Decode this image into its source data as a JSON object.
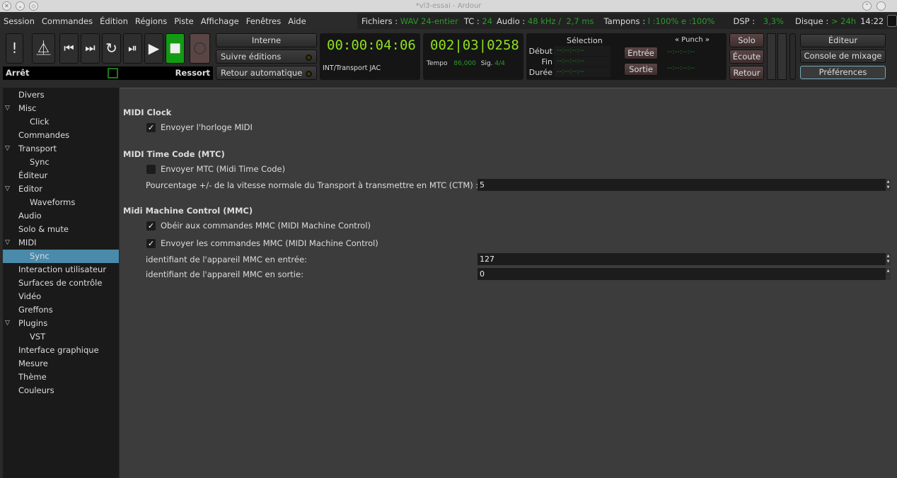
{
  "window": {
    "title": "*vl3-essai - Ardour"
  },
  "menu": [
    "Session",
    "Commandes",
    "Édition",
    "Régions",
    "Piste",
    "Affichage",
    "Fenêtres",
    "Aide"
  ],
  "status": {
    "files_label": "Fichiers : ",
    "files_value": "WAV 24-entier",
    "tc_label": "TC : ",
    "tc_value": "24",
    "audio_label": "Audio : ",
    "audio_value": "48 kHz /  2,7 ms",
    "buffers_label": "Tampons : ",
    "buffers_value": "l :100% e :100%",
    "dsp_label": "DSP : ",
    "dsp_value": "3,3%",
    "disk_label": "Disque : ",
    "disk_value": "> 24h",
    "time": "14:22"
  },
  "transport": {
    "state": "Arrêt",
    "spring": "Ressort",
    "sync_label": "Interne",
    "follow_edits": "Suivre éditions",
    "auto_return": "Retour automatique"
  },
  "clock1": {
    "value": "00:00:04:06",
    "source": "INT/Transport JAC"
  },
  "clock2": {
    "value": "002|03|0258",
    "tempo_label": "Tempo",
    "tempo_value": "86,000",
    "sig_label": "Sig.",
    "sig_value": "4/4"
  },
  "selection": {
    "title": "Sélection",
    "start": "Début",
    "end": "Fin",
    "length": "Durée",
    "empty": "--:--:--:--",
    "punch": "« Punch »",
    "in": "Entrée",
    "out": "Sortie"
  },
  "monitor": {
    "solo": "Solo",
    "listen": "Écoute",
    "return": "Retour"
  },
  "windows": {
    "editor": "Éditeur",
    "mixer": "Console de mixage",
    "prefs": "Préférences"
  },
  "sidebar": [
    {
      "label": "Divers",
      "level": 0
    },
    {
      "label": "Misc",
      "level": 0,
      "expanded": true
    },
    {
      "label": "Click",
      "level": 1
    },
    {
      "label": "Commandes",
      "level": 0
    },
    {
      "label": "Transport",
      "level": 0,
      "expanded": true
    },
    {
      "label": "Sync",
      "level": 1
    },
    {
      "label": "Éditeur",
      "level": 0
    },
    {
      "label": "Editor",
      "level": 0,
      "expanded": true
    },
    {
      "label": "Waveforms",
      "level": 1
    },
    {
      "label": "Audio",
      "level": 0
    },
    {
      "label": "Solo & mute",
      "level": 0
    },
    {
      "label": "MIDI",
      "level": 0,
      "expanded": true
    },
    {
      "label": "Sync",
      "level": 1,
      "selected": true
    },
    {
      "label": "Interaction utilisateur",
      "level": 0
    },
    {
      "label": "Surfaces de contrôle",
      "level": 0
    },
    {
      "label": "Vidéo",
      "level": 0
    },
    {
      "label": "Greffons",
      "level": 0
    },
    {
      "label": "Plugins",
      "level": 0,
      "expanded": true
    },
    {
      "label": "VST",
      "level": 1
    },
    {
      "label": "Interface graphique",
      "level": 0
    },
    {
      "label": "Mesure",
      "level": 0
    },
    {
      "label": "Thème",
      "level": 0
    },
    {
      "label": "Couleurs",
      "level": 0
    }
  ],
  "content": {
    "midi_clock": "MIDI Clock",
    "send_clock": "Envoyer l'horloge MIDI",
    "send_clock_checked": true,
    "mtc": "MIDI Time Code (MTC)",
    "send_mtc": "Envoyer MTC (Midi Time Code)",
    "send_mtc_checked": false,
    "mtc_pct_label": "Pourcentage +/- de la vitesse normale du Transport à transmettre en MTC (CTM) :",
    "mtc_pct_value": "5",
    "mmc": "Midi Machine Control (MMC)",
    "obey_mmc": "Obéir aux commandes MMC (MIDI Machine Control)",
    "obey_mmc_checked": true,
    "send_mmc": "Envoyer les commandes MMC (MIDI Machine Control)",
    "send_mmc_checked": true,
    "mmc_in_label": "identifiant de l'appareil MMC en entrée:",
    "mmc_in_value": "127",
    "mmc_out_label": "identifiant de l'appareil MMC en sortie:",
    "mmc_out_value": "0"
  },
  "colors": {
    "accent": "#4a8aaa",
    "clock": "#8fe01c",
    "status_green": "#2a9a2a"
  }
}
